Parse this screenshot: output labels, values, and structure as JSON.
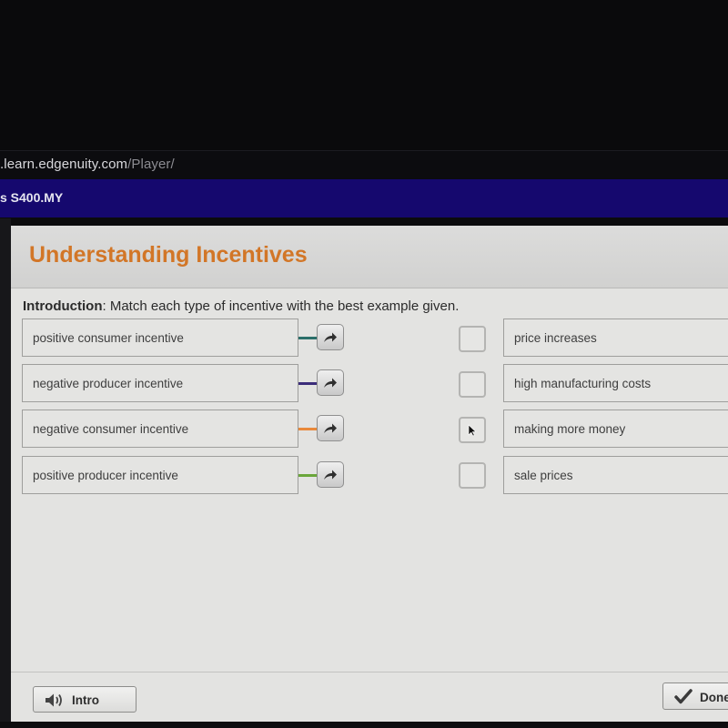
{
  "browser": {
    "url_domain": ".learn.edgenuity.com",
    "url_path": "/Player/"
  },
  "course": {
    "title": "s S400.MY"
  },
  "activity": {
    "title": "Understanding Incentives",
    "instructions_label": "Introduction",
    "instructions_text": ": Match each type of incentive with the best example given."
  },
  "left_items": [
    {
      "label": "positive consumer incentive",
      "connector_color": "#2b6f6a"
    },
    {
      "label": "negative producer incentive",
      "connector_color": "#3b2d7a"
    },
    {
      "label": "negative consumer incentive",
      "connector_color": "#e9893b"
    },
    {
      "label": "positive producer incentive",
      "connector_color": "#6aa63a"
    }
  ],
  "right_items": [
    {
      "label": "price increases"
    },
    {
      "label": "high manufacturing costs"
    },
    {
      "label": "making more money"
    },
    {
      "label": "sale prices"
    }
  ],
  "footer": {
    "intro_label": "Intro",
    "done_label": "Done"
  },
  "icons": {
    "arrow": "curved-arrow-right-icon",
    "speaker": "speaker-icon",
    "check": "checkmark-icon",
    "cursor": "mouse-pointer-icon"
  }
}
